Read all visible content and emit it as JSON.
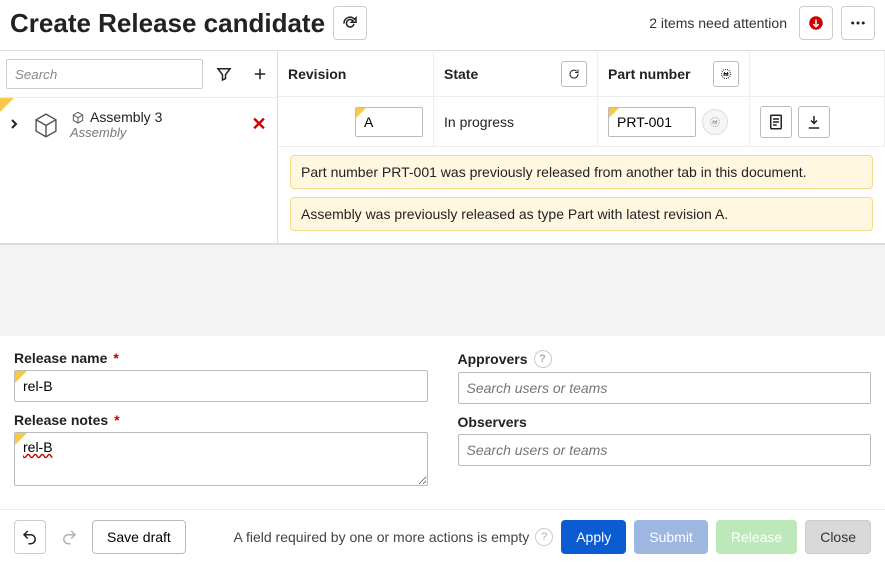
{
  "header": {
    "title": "Create Release candidate",
    "attention_text": "2 items need attention"
  },
  "sidebar": {
    "search_placeholder": "Search",
    "items": [
      {
        "name": "Assembly 3",
        "sub": "Assembly"
      }
    ]
  },
  "columns": {
    "revision": "Revision",
    "state": "State",
    "part_number": "Part number"
  },
  "rows": [
    {
      "revision": "A",
      "state": "In progress",
      "part_number": "PRT-001"
    }
  ],
  "warnings": [
    "Part number PRT-001 was previously released from another tab in this document.",
    "Assembly was previously released as type Part with latest revision A."
  ],
  "form": {
    "release_name_label": "Release name",
    "release_name_value": "rel-B",
    "release_notes_label": "Release notes",
    "release_notes_value": "rel-B",
    "approvers_label": "Approvers",
    "approvers_placeholder": "Search users or teams",
    "observers_label": "Observers",
    "observers_placeholder": "Search users or teams"
  },
  "footer": {
    "save_draft": "Save draft",
    "message": "A field required by one or more actions is empty",
    "apply": "Apply",
    "submit": "Submit",
    "release": "Release",
    "close": "Close"
  }
}
